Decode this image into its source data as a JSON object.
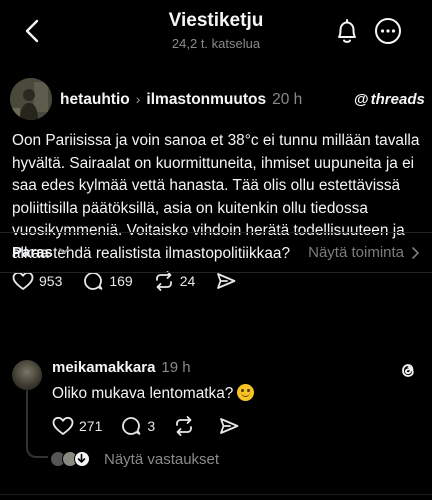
{
  "header": {
    "title": "Viestiketju",
    "subtitle": "24,2 t. katselua"
  },
  "post": {
    "username": "hetauhtio",
    "topic": "ilmastonmuutos",
    "time": "20 h",
    "brand": "threads",
    "text": "Oon Pariisissa ja voin sanoa et  38°c ei tunnu millään tavalla hyvältä. Sairaalat on kuormittuneita, ihmiset uupuneita ja ei saa edes kylmää vettä hanasta. Tää olis ollu estettävissä poliittisilla päätöksillä, asia on kuitenkin ollu tiedossa vuosikymmeniä. Voitaisko vihdoin herätä todellisuuteen ja alkaa tehdä realistista ilmastopolitiikkaa?",
    "likes": "953",
    "comments": "169",
    "reposts": "24"
  },
  "sort": {
    "label": "Paras",
    "view_activity": "Näytä toiminta"
  },
  "reply": {
    "username": "meikamakkara",
    "time": "19 h",
    "text": "Oliko mukava lentomatka?",
    "likes": "271",
    "comments": "3",
    "view_replies": "Näytä vastaukset"
  },
  "colors": {
    "background": "#000000",
    "text": "#f3f5f7",
    "muted": "#8a8a8a",
    "divider": "#222222"
  }
}
